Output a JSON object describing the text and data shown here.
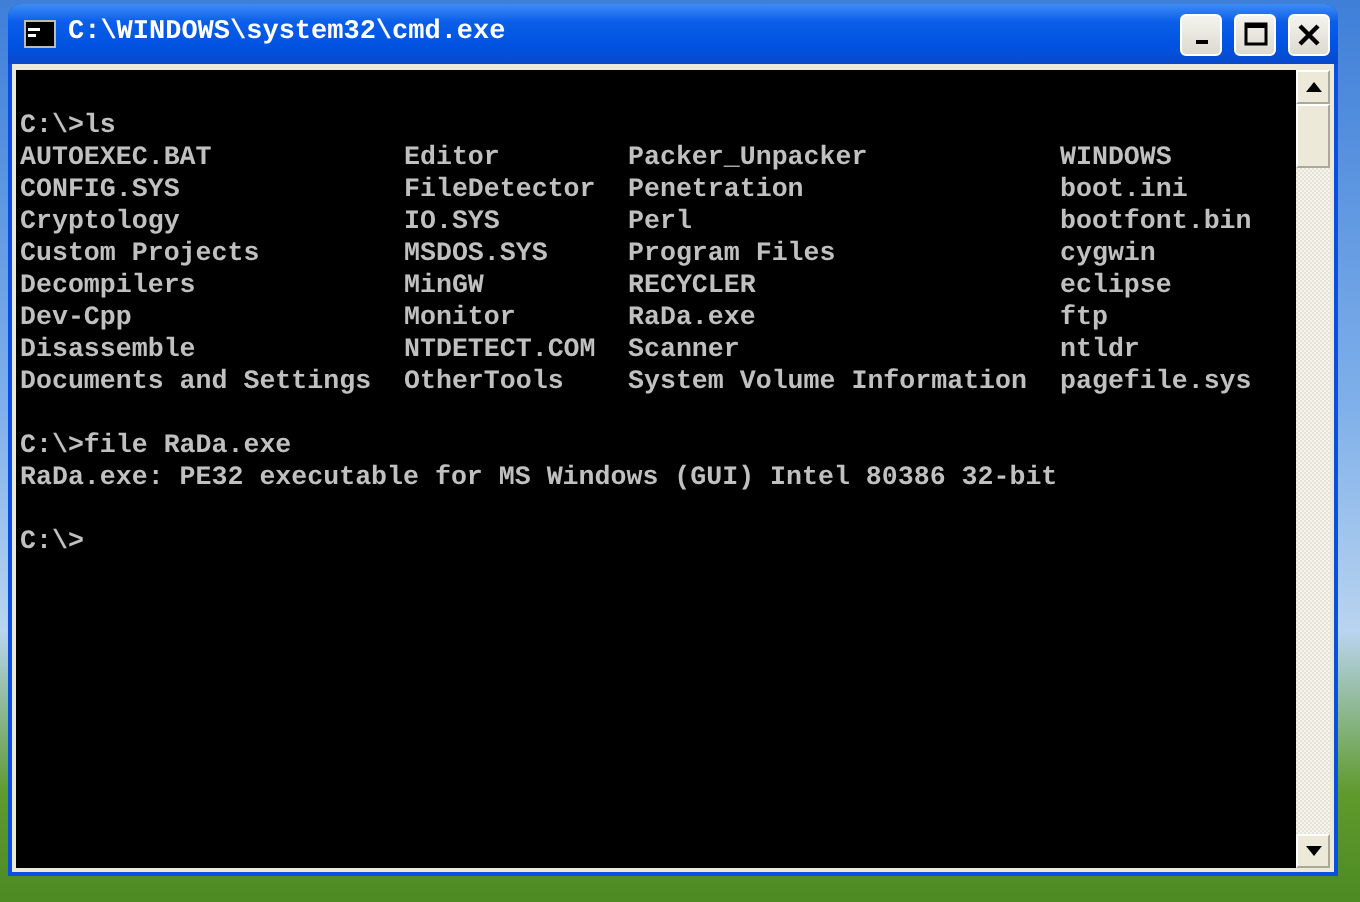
{
  "window": {
    "title": "C:\\WINDOWS\\system32\\cmd.exe"
  },
  "console": [
    {
      "kind": "gap"
    },
    {
      "kind": "line",
      "text": "C:\\>ls"
    },
    {
      "kind": "listing",
      "rows": [
        [
          "AUTOEXEC.BAT",
          "Editor",
          "Packer_Unpacker",
          "WINDOWS"
        ],
        [
          "CONFIG.SYS",
          "FileDetector",
          "Penetration",
          "boot.ini"
        ],
        [
          "Cryptology",
          "IO.SYS",
          "Perl",
          "bootfont.bin"
        ],
        [
          "Custom Projects",
          "MSDOS.SYS",
          "Program Files",
          "cygwin"
        ],
        [
          "Decompilers",
          "MinGW",
          "RECYCLER",
          "eclipse"
        ],
        [
          "Dev-Cpp",
          "Monitor",
          "RaDa.exe",
          "ftp"
        ],
        [
          "Disassemble",
          "NTDETECT.COM",
          "Scanner",
          "ntldr"
        ],
        [
          "Documents and Settings",
          "OtherTools",
          "System Volume Information",
          "pagefile.sys"
        ]
      ]
    },
    {
      "kind": "gap"
    },
    {
      "kind": "line",
      "text": "C:\\>file RaDa.exe"
    },
    {
      "kind": "line",
      "text": "RaDa.exe: PE32 executable for MS Windows (GUI) Intel 80386 32-bit"
    },
    {
      "kind": "gap"
    },
    {
      "kind": "line",
      "text": "C:\\>"
    }
  ]
}
